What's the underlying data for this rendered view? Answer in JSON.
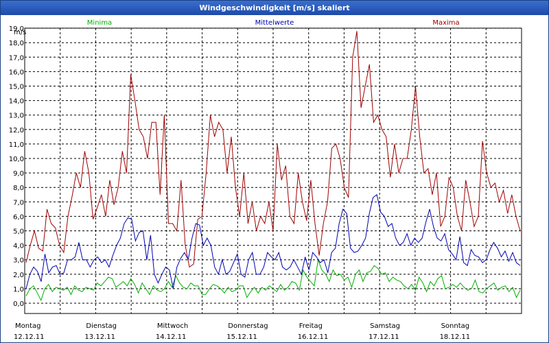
{
  "window": {
    "title": "Windgeschwindigkeit [m/s] skaliert"
  },
  "chart_data": {
    "type": "line",
    "title": "Windgeschwindigkeit [m/s] skaliert",
    "ylabel": "m/s",
    "ylim": [
      -1,
      20
    ],
    "xlim": [
      0,
      7
    ],
    "grid": true,
    "legend_position": "top",
    "yticks": [
      "0,0",
      "1,0",
      "2,0",
      "3,0",
      "4,0",
      "5,0",
      "6,0",
      "7,0",
      "8,0",
      "9,0",
      "10,0",
      "11,0",
      "12,0",
      "13,0",
      "14,0",
      "15,0",
      "16,0",
      "17,0",
      "18,0",
      "19,0"
    ],
    "days": [
      {
        "name": "Montag",
        "date": "12.12.11"
      },
      {
        "name": "Dienstag",
        "date": "13.12.11"
      },
      {
        "name": "Mittwoch",
        "date": "14.12.11"
      },
      {
        "name": "Donnerstag",
        "date": "15.12.11"
      },
      {
        "name": "Freitag",
        "date": "16.12.11"
      },
      {
        "name": "Samstag",
        "date": "17.12.11"
      },
      {
        "name": "Sonntag",
        "date": "18.12.11"
      }
    ],
    "series": [
      {
        "name": "Minima",
        "color": "#00b000",
        "values": [
          0.5,
          1.0,
          1.2,
          0.7,
          0.2,
          1.0,
          1.3,
          0.8,
          1.1,
          1.0,
          0.9,
          1.1,
          0.6,
          1.2,
          0.9,
          0.8,
          1.1,
          1.0,
          0.9,
          1.4,
          1.2,
          1.5,
          1.8,
          1.7,
          1.1,
          1.3,
          1.5,
          1.2,
          1.7,
          1.3,
          0.7,
          1.4,
          1.0,
          0.6,
          1.2,
          0.9,
          0.8,
          1.0,
          1.5,
          1.1,
          1.9,
          1.4,
          1.1,
          1.0,
          1.4,
          1.2,
          1.2,
          0.6,
          0.6,
          1.0,
          1.3,
          1.2,
          1.0,
          0.7,
          1.1,
          0.8,
          0.9,
          1.2,
          1.2,
          0.4,
          0.8,
          1.1,
          0.7,
          1.1,
          0.9,
          1.2,
          1.0,
          0.8,
          1.3,
          0.9,
          1.1,
          1.5,
          1.4,
          0.9,
          2.3,
          1.8,
          1.5,
          1.2,
          3.0,
          2.3,
          2.0,
          1.5,
          2.3,
          1.9,
          2.0,
          1.6,
          1.8,
          1.1,
          2.0,
          2.3,
          1.5,
          2.1,
          2.2,
          2.6,
          2.4,
          2.0,
          2.1,
          1.5,
          1.8,
          1.6,
          1.5,
          1.2,
          1.0,
          1.3,
          0.9,
          1.8,
          1.4,
          0.8,
          1.5,
          1.2,
          1.7,
          1.9,
          1.0,
          1.1,
          1.3,
          1.1,
          1.4,
          1.1,
          0.9,
          1.0,
          1.6,
          0.8,
          0.7,
          1.0,
          1.2,
          1.4,
          0.9,
          1.1,
          1.2,
          0.8,
          1.1,
          0.4,
          0.9
        ]
      },
      {
        "name": "Mittelwerte",
        "color": "#0000b0",
        "values": [
          1.0,
          2.0,
          2.5,
          2.2,
          1.5,
          3.4,
          2.1,
          2.5,
          2.6,
          2.0,
          2.1,
          3.0,
          3.0,
          3.2,
          4.2,
          3.0,
          3.0,
          2.5,
          3.0,
          3.2,
          2.8,
          3.0,
          2.5,
          3.3,
          4.0,
          4.5,
          5.5,
          5.9,
          5.8,
          4.3,
          4.9,
          5.0,
          3.0,
          4.7,
          2.0,
          1.4,
          2.0,
          2.5,
          2.3,
          1.0,
          2.5,
          3.1,
          3.5,
          3.0,
          4.5,
          5.5,
          5.4,
          4.0,
          4.5,
          4.0,
          2.5,
          2.0,
          3.0,
          2.0,
          2.2,
          2.8,
          3.4,
          2.0,
          1.8,
          3.0,
          3.5,
          2.0,
          2.0,
          2.5,
          3.5,
          3.2,
          3.0,
          3.5,
          2.5,
          2.3,
          2.5,
          3.0,
          2.5,
          2.0,
          3.2,
          2.3,
          3.5,
          3.2,
          2.8,
          3.0,
          2.1,
          3.5,
          3.8,
          5.5,
          6.5,
          6.2,
          3.8,
          3.5,
          3.6,
          4.0,
          4.5,
          6.2,
          7.3,
          7.5,
          6.3,
          6.0,
          5.3,
          5.5,
          4.5,
          4.0,
          4.2,
          4.8,
          4.0,
          4.5,
          4.2,
          4.5,
          5.6,
          6.5,
          5.3,
          4.5,
          4.3,
          4.8,
          3.7,
          3.4,
          3.0,
          4.6,
          2.8,
          2.6,
          3.7,
          3.3,
          3.2,
          2.8,
          3.0,
          3.7,
          4.2,
          3.8,
          3.2,
          3.6,
          2.9,
          3.5,
          2.8,
          2.6
        ]
      },
      {
        "name": "Maxima",
        "color": "#a00000",
        "values": [
          2.8,
          4.0,
          5.0,
          3.8,
          3.6,
          6.5,
          5.5,
          5.2,
          4.0,
          3.5,
          6.0,
          7.4,
          9.0,
          8.0,
          10.5,
          9.0,
          5.8,
          6.6,
          7.5,
          6.0,
          8.5,
          6.8,
          8.0,
          10.5,
          9.0,
          15.8,
          14.0,
          12.0,
          11.5,
          10.0,
          12.5,
          12.5,
          7.5,
          13.0,
          5.5,
          5.5,
          5.0,
          8.5,
          4.0,
          2.5,
          2.7,
          5.8,
          6.0,
          9.0,
          13.0,
          11.5,
          12.5,
          12.0,
          9.0,
          11.5,
          8.0,
          6.0,
          9.0,
          5.5,
          7.0,
          5.0,
          6.0,
          5.5,
          7.0,
          5.0,
          11.0,
          8.5,
          9.5,
          6.0,
          5.5,
          9.0,
          7.0,
          5.7,
          8.5,
          5.5,
          3.3,
          5.5,
          7.0,
          10.7,
          11.0,
          10.0,
          8.0,
          7.3,
          17.0,
          18.8,
          13.5,
          15.0,
          16.5,
          12.5,
          13.0,
          12.0,
          11.5,
          8.7,
          11.0,
          9.0,
          10.0,
          10.0,
          12.0,
          15.0,
          11.5,
          9.0,
          9.3,
          7.5,
          9.0,
          5.3,
          6.0,
          8.7,
          8.0,
          6.0,
          5.0,
          8.5,
          7.0,
          5.3,
          6.0,
          11.2,
          9.0,
          8.0,
          8.3,
          7.0,
          7.8,
          6.2,
          7.5,
          6.0,
          5.0
        ]
      }
    ]
  }
}
